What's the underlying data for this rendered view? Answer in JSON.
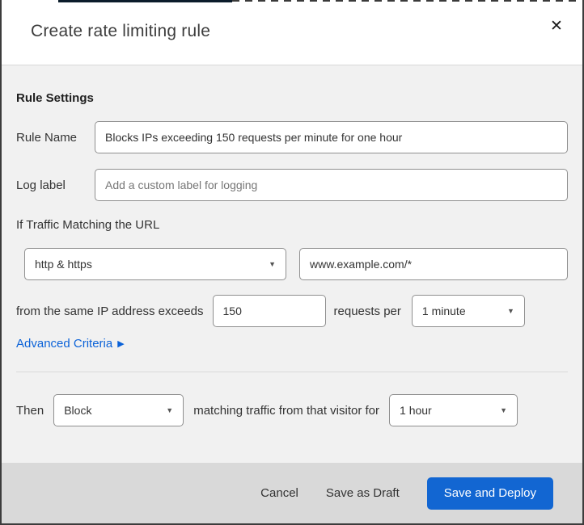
{
  "dialog": {
    "title": "Create rate limiting rule",
    "close_icon": "✕"
  },
  "section": {
    "heading": "Rule Settings"
  },
  "fields": {
    "rule_name": {
      "label": "Rule Name",
      "value": "Blocks IPs exceeding 150 requests per minute for one hour"
    },
    "log_label": {
      "label": "Log label",
      "placeholder": "Add a custom label for logging"
    },
    "traffic_heading": "If Traffic Matching the URL",
    "scheme_select": {
      "value": "http & https",
      "chevron": "▼"
    },
    "url_input": {
      "value": "www.example.com/*"
    },
    "threshold": {
      "prefix": "from the same IP address exceeds",
      "count_value": "150",
      "middle": "requests per",
      "period_value": "1 minute",
      "chevron": "▼"
    },
    "advanced_link": {
      "label": "Advanced Criteria",
      "arrow": "▶"
    },
    "then": {
      "label": "Then",
      "action_value": "Block",
      "middle": "matching traffic from that visitor for",
      "duration_value": "1 hour",
      "chevron": "▼"
    }
  },
  "footer": {
    "cancel": "Cancel",
    "save_draft": "Save as Draft",
    "save_deploy": "Save and Deploy"
  },
  "colors": {
    "primary_button_blue": "#1266d2",
    "link_blue": "#0b62d8",
    "body_background": "#f1f1f1",
    "footer_background": "#d9d9d9",
    "input_border_gray": "#8f8f8f",
    "divider_gray": "#d9d9d9",
    "title_text": "#3d3d3d",
    "top_sliver_navy": "#0b1c2b"
  }
}
